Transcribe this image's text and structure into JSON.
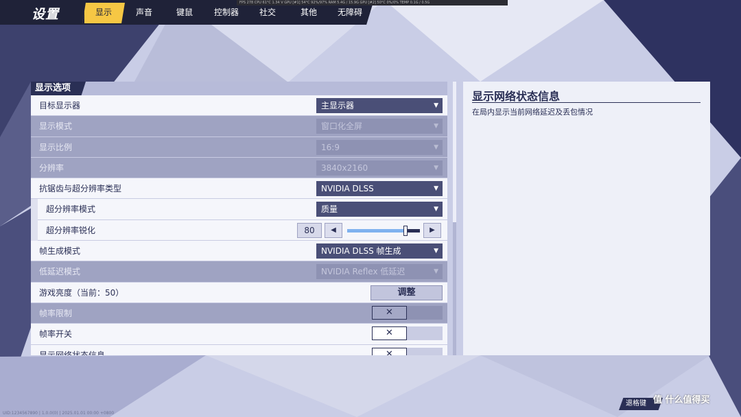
{
  "header": {
    "title": "设置",
    "tabs": [
      {
        "label": "显示",
        "active": true
      },
      {
        "label": "声音"
      },
      {
        "label": "键鼠"
      },
      {
        "label": "控制器"
      },
      {
        "label": "社交"
      },
      {
        "label": "其他"
      },
      {
        "label": "无障碍"
      }
    ],
    "perf_overlay": "FPS 278 CPU 61°C 1.34 V GPU [#1] 54°C 92%/97% RAM 5.4G / 15.9G GPU [#2] 50°C 0%/0% TEMP 0.1G / 0.5G"
  },
  "section": {
    "title": "显示选项"
  },
  "settings": {
    "target_display": {
      "label": "目标显示器",
      "value": "主显示器"
    },
    "display_mode": {
      "label": "显示模式",
      "value": "窗口化全屏"
    },
    "aspect_ratio": {
      "label": "显示比例",
      "value": "16:9"
    },
    "resolution": {
      "label": "分辨率",
      "value": "3840x2160"
    },
    "aa_type": {
      "label": "抗锯齿与超分辨率类型",
      "value": "NVIDIA DLSS"
    },
    "upscale_mode": {
      "label": "超分辨率模式",
      "value": "质量"
    },
    "sharpness": {
      "label": "超分辨率锐化",
      "value": "80",
      "left": "◀",
      "right": "▶",
      "fraction": 0.8
    },
    "frame_gen": {
      "label": "帧生成模式",
      "value": "NVIDIA DLSS 帧生成"
    },
    "low_latency": {
      "label": "低延迟模式",
      "value": "NVIDIA Reflex 低延迟"
    },
    "brightness": {
      "label": "游戏亮度（当前：50）",
      "button": "调整"
    },
    "fps_limit": {
      "label": "帧率限制",
      "mark": "✕"
    },
    "fps_toggle": {
      "label": "帧率开关",
      "mark": "✕"
    },
    "net_info": {
      "label": "显示网络状态信息",
      "mark": "✕"
    }
  },
  "dropdown_arrow": "▼",
  "info_panel": {
    "title": "显示网络状态信息",
    "description": "在局内显示当前网络延迟及丢包情况"
  },
  "footer": {
    "id_text": "UID:1234567890 | 1.0.0(0) | 2025.01.01 00:00 +0800",
    "exit_label": "退格键",
    "watermark": "值 什么值得买"
  },
  "colors": {
    "accent": "#f6c744",
    "nav_bg": "#1f2238",
    "dropdown_bg": "#4a4f77",
    "slider_fill": "#7fb2ef"
  }
}
